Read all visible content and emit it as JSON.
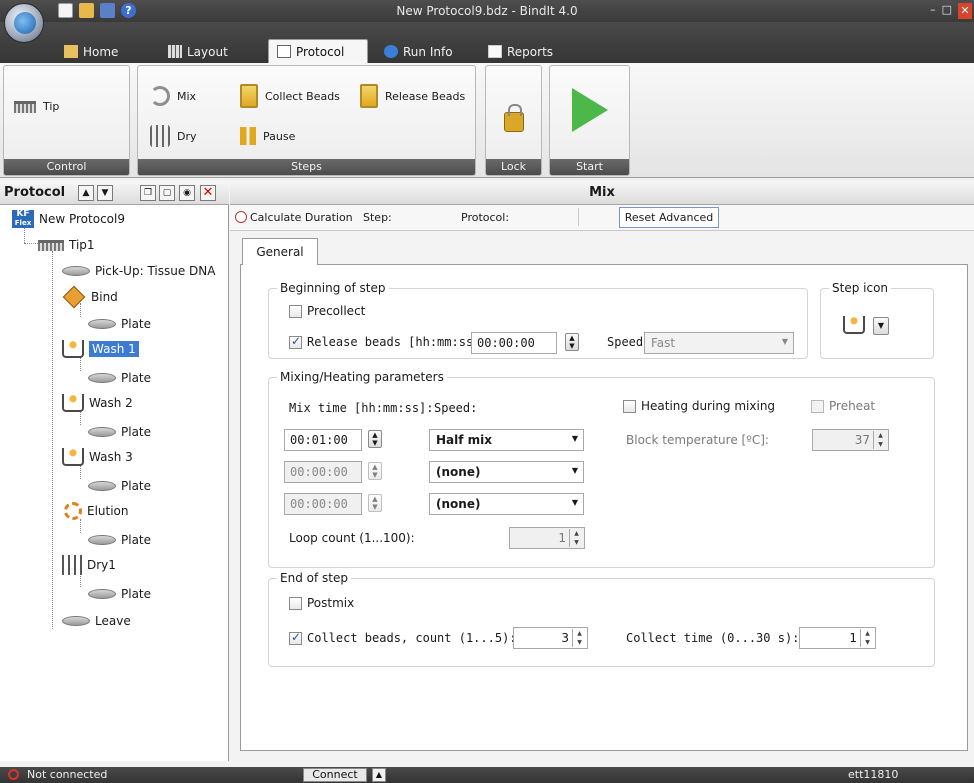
{
  "window": {
    "title": "New Protocol9.bdz - BindIt 4.0",
    "controls": {
      "minimize": "–",
      "maximize": "□",
      "close": "✕"
    },
    "help_glyph": "?"
  },
  "tabs": [
    {
      "label": "Home"
    },
    {
      "label": "Layout"
    },
    {
      "label": "Protocol"
    },
    {
      "label": "Run Info"
    },
    {
      "label": "Reports"
    }
  ],
  "ribbon": {
    "control": {
      "caption": "Control",
      "tip": "Tip"
    },
    "steps": {
      "caption": "Steps",
      "mix": "Mix",
      "dry": "Dry",
      "collect_beads": "Collect Beads",
      "pause": "Pause",
      "release_beads": "Release Beads"
    },
    "lock": {
      "caption": "Lock"
    },
    "start": {
      "caption": "Start"
    }
  },
  "left_panel": {
    "title": "Protocol",
    "kf_badge": {
      "top": "KF",
      "bottom": "Flex"
    },
    "tree": {
      "root": "New Protocol9",
      "tip": "Tip1",
      "pickup": "Pick-Up: Tissue DNA",
      "bind": "Bind",
      "plate": "Plate",
      "wash1": "Wash 1",
      "wash2": "Wash 2",
      "wash3": "Wash 3",
      "elution": "Elution",
      "dry1": "Dry1",
      "leave": "Leave"
    },
    "selected": "Wash 1"
  },
  "main": {
    "header": "Mix",
    "toolbar": {
      "calc_duration": "Calculate Duration",
      "step": "Step:",
      "protocol": "Protocol:",
      "reset_advanced": "Reset Advanced"
    },
    "tab_general": "General",
    "beginning": {
      "legend": "Beginning of step",
      "precollect": "Precollect",
      "precollect_checked": false,
      "release_beads": "Release beads [hh:mm:ss]:",
      "release_checked": true,
      "release_time": "00:00:00",
      "speed_label": "Speed:",
      "speed_value": "Fast"
    },
    "step_icon": {
      "legend": "Step icon"
    },
    "mixing": {
      "legend": "Mixing/Heating parameters",
      "mix_time_label": "Mix time [hh:mm:ss]:",
      "speed_label": "Speed:",
      "rows": [
        {
          "time": "00:01:00",
          "speed": "Half mix"
        },
        {
          "time": "00:00:00",
          "speed": "(none)"
        },
        {
          "time": "00:00:00",
          "speed": "(none)"
        }
      ],
      "loop_label": "Loop count (1...100):",
      "loop_value": "1",
      "heating_label": "Heating during mixing",
      "heating_checked": false,
      "preheat_label": "Preheat",
      "preheat_checked": false,
      "block_temp_label": "Block temperature [ºC]:",
      "block_temp_value": "37"
    },
    "end": {
      "legend": "End of step",
      "postmix": "Postmix",
      "postmix_checked": false,
      "collect_label": "Collect beads, count (1...5):",
      "collect_checked": true,
      "collect_value": "3",
      "collect_time_label": "Collect time (0...30 s):",
      "collect_time_value": "1"
    }
  },
  "statusbar": {
    "connection": "Not connected",
    "connect_btn": "Connect",
    "up_glyph": "▲",
    "user": "ett11810"
  },
  "colors": {
    "selection": "#3b7bd1",
    "start_green": "#4cb84a",
    "titlebar": "#3a3a3a"
  }
}
